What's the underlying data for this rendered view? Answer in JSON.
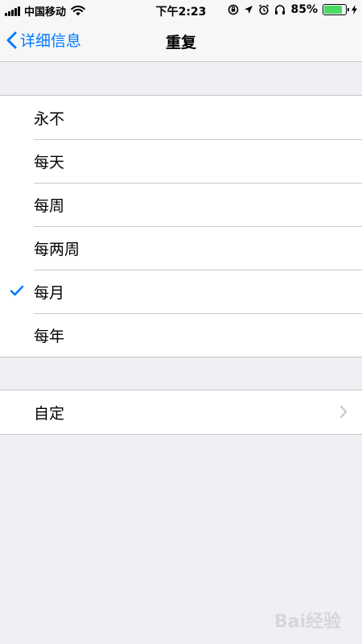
{
  "status_bar": {
    "carrier": "中国移动",
    "time": "下午2:23",
    "battery_percent": "85%",
    "battery_level": 0.85,
    "icons": [
      "signal-icon",
      "wifi-icon",
      "rotation-lock-icon",
      "location-icon",
      "alarm-icon",
      "headphones-icon",
      "battery-icon",
      "charging-icon"
    ]
  },
  "nav": {
    "back_label": "详细信息",
    "title": "重复"
  },
  "options": [
    {
      "label": "永不",
      "selected": false
    },
    {
      "label": "每天",
      "selected": false
    },
    {
      "label": "每周",
      "selected": false
    },
    {
      "label": "每两周",
      "selected": false
    },
    {
      "label": "每月",
      "selected": true
    },
    {
      "label": "每年",
      "selected": false
    }
  ],
  "custom": {
    "label": "自定"
  },
  "watermark": {
    "text": "Bai经验"
  },
  "colors": {
    "accent": "#007aff",
    "background": "#efeff4",
    "battery_fill": "#4cd964"
  }
}
